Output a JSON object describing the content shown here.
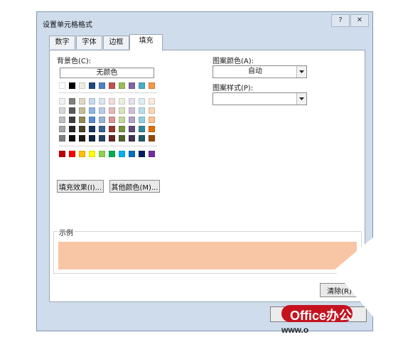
{
  "dialog": {
    "title": "设置单元格格式",
    "help_label": "?",
    "close_label": "✕"
  },
  "tabs": [
    {
      "label": "数字",
      "active": false
    },
    {
      "label": "字体",
      "active": false
    },
    {
      "label": "边框",
      "active": false
    },
    {
      "label": "填充",
      "active": true
    }
  ],
  "fill": {
    "background_label": "背景色(C):",
    "no_color_label": "无颜色",
    "theme_top_row": [
      "#ffffff",
      "#000000",
      "#eeece1",
      "#1f497d",
      "#4f81bd",
      "#c0504d",
      "#9bbb59",
      "#8064a2",
      "#4bacc6",
      "#f79646"
    ],
    "theme_shades": [
      [
        "#f2f2f2",
        "#7f7f7f",
        "#ddd9c3",
        "#c6d9f0",
        "#dbe5f1",
        "#f2dcdb",
        "#ebf1dd",
        "#e5e0ec",
        "#dbeef3",
        "#fdeada"
      ],
      [
        "#d8d8d8",
        "#595959",
        "#c4bd97",
        "#8db3e2",
        "#b8cce4",
        "#e5b9b7",
        "#d7e3bc",
        "#ccc1d9",
        "#b7dde8",
        "#fbd5b5"
      ],
      [
        "#bfbfbf",
        "#3f3f3f",
        "#938953",
        "#548dd4",
        "#95b3d7",
        "#d99694",
        "#c3d69b",
        "#b2a2c7",
        "#92cddc",
        "#fac08f"
      ],
      [
        "#a5a5a5",
        "#262626",
        "#494429",
        "#17365d",
        "#366092",
        "#953734",
        "#76923c",
        "#5f497a",
        "#31859b",
        "#e36c09"
      ],
      [
        "#7f7f7f",
        "#0c0c0c",
        "#1d1b10",
        "#0f243e",
        "#244061",
        "#632423",
        "#4f6128",
        "#3f3151",
        "#205867",
        "#974806"
      ]
    ],
    "standard_colors": [
      "#c00000",
      "#ff0000",
      "#ffc000",
      "#ffff00",
      "#92d050",
      "#00b050",
      "#00b0f0",
      "#0070c0",
      "#002060",
      "#7030a0"
    ],
    "selected_color": "#f8c7a6",
    "fill_effects_label": "填充效果(I)...",
    "more_colors_label": "其他颜色(M)...",
    "pattern_color_label": "图案颜色(A):",
    "pattern_color_value": "自动",
    "pattern_style_label": "图案样式(P):",
    "pattern_style_value": ""
  },
  "sample": {
    "label": "示例",
    "color": "#f8c6a4"
  },
  "buttons": {
    "clear_label": "清除(R)"
  },
  "watermark": {
    "brand": "Office办公",
    "url": "www.o"
  }
}
